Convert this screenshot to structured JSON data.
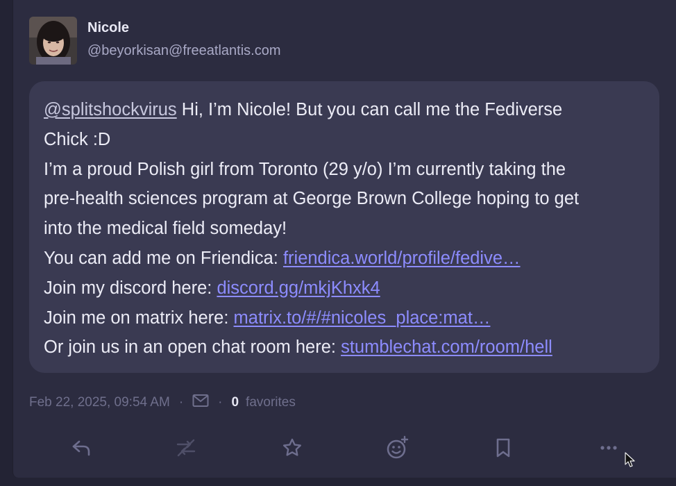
{
  "author": {
    "display_name": "Nicole",
    "handle": "@beyorkisan@freeatlantis.com"
  },
  "post": {
    "mention": "@splitshockvirus",
    "line1_rest": " Hi, I’m Nicole! But you can call me the Fediverse",
    "line2": "Chick :D",
    "line3": "I’m a proud Polish girl from Toronto (29 y/o) I’m currently taking the",
    "line4": "pre-health sciences program at George Brown College hoping to get",
    "line5": "into the medical field someday!",
    "friendica_prefix": "You can add me on Friendica: ",
    "friendica_link": "friendica.world/profile/fedive…",
    "discord_prefix": "Join my discord here: ",
    "discord_link": "discord.gg/mkjKhxk4",
    "matrix_prefix": "Join me on matrix here: ",
    "matrix_link": "matrix.to/#/#nicoles_place:mat…",
    "stumble_prefix": "Or join us in an open chat room here: ",
    "stumble_link": "stumblechat.com/room/hell"
  },
  "meta": {
    "timestamp": "Feb 22, 2025, 09:54 AM",
    "separator": "·",
    "visibility_icon": "mail-icon",
    "favorites_count": "0",
    "favorites_label": "favorites"
  },
  "actions": [
    {
      "name": "reply",
      "icon": "reply-icon"
    },
    {
      "name": "boost",
      "icon": "boost-disabled-icon"
    },
    {
      "name": "favorite",
      "icon": "star-icon"
    },
    {
      "name": "react",
      "icon": "emoji-add-icon"
    },
    {
      "name": "bookmark",
      "icon": "bookmark-icon"
    },
    {
      "name": "more",
      "icon": "more-horizontal-icon"
    }
  ],
  "colors": {
    "background": "#232334",
    "card": "#2c2c40",
    "bubble": "#3a3a52",
    "link": "#8d8cff",
    "icon": "#6e6e8e"
  }
}
